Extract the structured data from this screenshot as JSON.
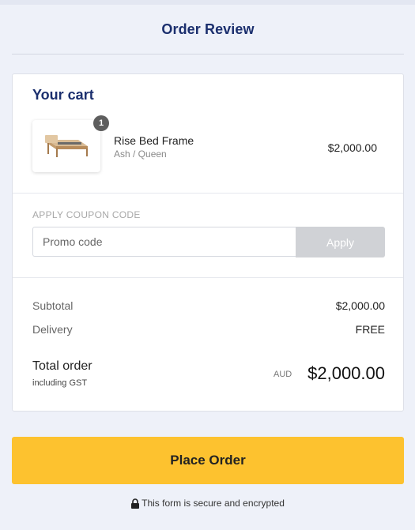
{
  "header": {
    "title": "Order Review"
  },
  "cart": {
    "heading": "Your cart",
    "items": [
      {
        "name": "Rise Bed Frame",
        "variant": "Ash / Queen",
        "price": "$2,000.00",
        "quantity": "1",
        "image_icon": "bed-frame-thumbnail"
      }
    ]
  },
  "coupon": {
    "label": "APPLY COUPON CODE",
    "placeholder": "Promo code",
    "value": "",
    "apply_label": "Apply"
  },
  "summary": {
    "subtotal_label": "Subtotal",
    "subtotal_value": "$2,000.00",
    "delivery_label": "Delivery",
    "delivery_value": "FREE",
    "total_label": "Total order",
    "total_sublabel": "including GST",
    "currency": "AUD",
    "total_value": "$2,000.00"
  },
  "actions": {
    "place_order_label": "Place Order"
  },
  "footer": {
    "secure_text": "This form is secure and encrypted",
    "icon": "lock-icon"
  },
  "colors": {
    "page_background": "#eef1f9",
    "heading_navy": "#1b2f6e",
    "place_order_yellow": "#fdc22f",
    "apply_disabled_gray": "#d0d2d6"
  }
}
